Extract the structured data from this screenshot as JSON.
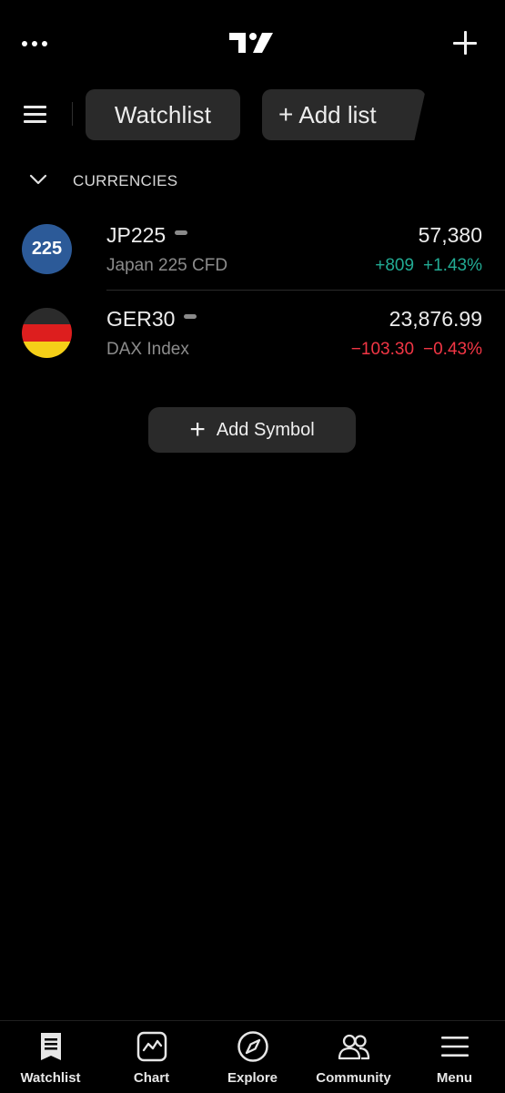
{
  "header": {
    "more_icon": "more-dots-icon",
    "logo": "tradingview-logo",
    "add_icon": "plus-icon"
  },
  "tabs": {
    "menu_icon": "hamburger-icon",
    "watchlist_label": "Watchlist",
    "add_list_label": "Add list",
    "add_list_icon": "+"
  },
  "section": {
    "title": "CURRENCIES",
    "chevron_icon": "chevron-down-icon"
  },
  "symbols": [
    {
      "avatar_text": "225",
      "ticker": "JP225",
      "description": "Japan 225 CFD",
      "price": "57,380",
      "change": "+809",
      "change_percent": "+1.43%",
      "direction": "up"
    },
    {
      "avatar_text": "",
      "ticker": "GER30",
      "description": "DAX Index",
      "price": "23,876.99",
      "change": "−103.30",
      "change_percent": "−0.43%",
      "direction": "down"
    }
  ],
  "add_symbol": {
    "icon": "+",
    "label": "Add Symbol"
  },
  "bottom_nav": [
    {
      "label": "Watchlist",
      "icon": "watchlist-icon"
    },
    {
      "label": "Chart",
      "icon": "chart-icon"
    },
    {
      "label": "Explore",
      "icon": "compass-icon"
    },
    {
      "label": "Community",
      "icon": "people-icon"
    },
    {
      "label": "Menu",
      "icon": "menu-icon"
    }
  ],
  "colors": {
    "background": "#000000",
    "surface": "#2a2a2a",
    "positive": "#22ab94",
    "negative": "#f23645",
    "jp_avatar": "#2c5a98",
    "flag_black": "#2b2b2b",
    "flag_red": "#dd1e1e",
    "flag_gold": "#f5cf18"
  }
}
